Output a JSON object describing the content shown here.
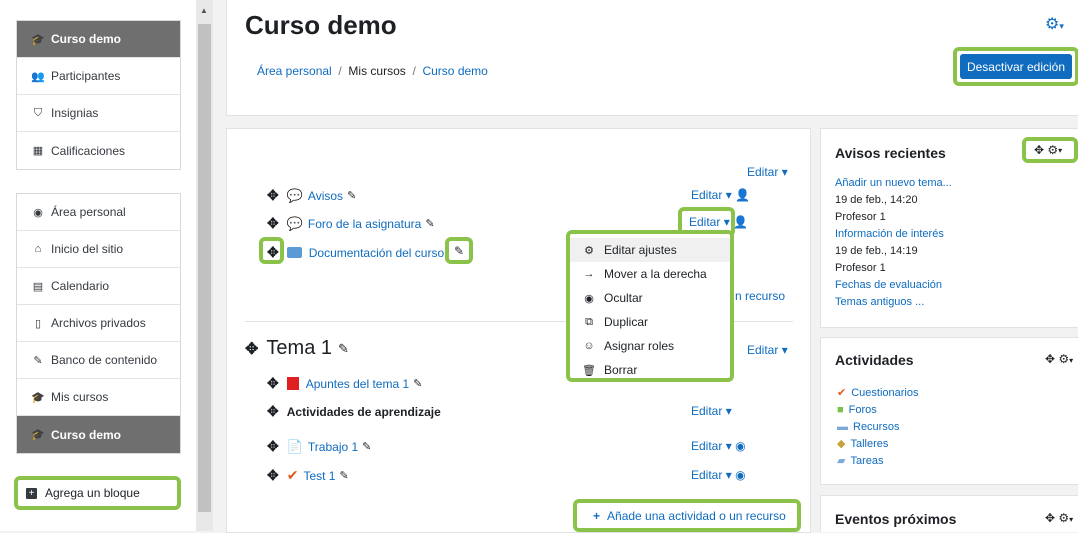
{
  "sidebar": {
    "nav1": [
      {
        "label": "Curso demo",
        "icon": "graduation-cap-icon",
        "active": true
      },
      {
        "label": "Participantes",
        "icon": "users-icon"
      },
      {
        "label": "Insignias",
        "icon": "shield-icon"
      },
      {
        "label": "Calificaciones",
        "icon": "table-icon"
      }
    ],
    "nav2": [
      {
        "label": "Área personal",
        "icon": "dashboard-icon"
      },
      {
        "label": "Inicio del sitio",
        "icon": "home-icon"
      },
      {
        "label": "Calendario",
        "icon": "calendar-icon"
      },
      {
        "label": "Archivos privados",
        "icon": "file-icon"
      },
      {
        "label": "Banco de contenido",
        "icon": "pencil-icon"
      },
      {
        "label": "Mis cursos",
        "icon": "graduation-cap-icon"
      },
      {
        "label": "Curso demo",
        "icon": "graduation-cap-icon",
        "active": true
      }
    ],
    "add_block": "Agrega un bloque"
  },
  "header": {
    "title": "Curso demo",
    "breadcrumb": [
      "Área personal",
      "Mis cursos",
      "Curso demo"
    ],
    "toggle_edit": "Desactivar edición"
  },
  "section0": {
    "edit_label": "Editar",
    "items": [
      {
        "name": "Avisos",
        "icon": "forum-icon",
        "edit": "Editar"
      },
      {
        "name": "Foro de la asignatura",
        "icon": "forum-icon",
        "edit": "Editar"
      },
      {
        "name": "Documentación del curso",
        "icon": "folder-icon"
      }
    ],
    "add_resource_partial": "n recurso"
  },
  "context_menu": [
    {
      "label": "Editar ajustes",
      "icon": "gear-icon"
    },
    {
      "label": "Mover a la derecha",
      "icon": "arrow-right-icon"
    },
    {
      "label": "Ocultar",
      "icon": "eye-icon"
    },
    {
      "label": "Duplicar",
      "icon": "copy-icon"
    },
    {
      "label": "Asignar roles",
      "icon": "user-circle-icon"
    },
    {
      "label": "Borrar",
      "icon": "trash-icon"
    }
  ],
  "section1": {
    "title": "Tema 1",
    "edit_label": "Editar",
    "items": [
      {
        "name": "Apuntes del tema 1",
        "icon": "pdf-icon"
      },
      {
        "name": "Actividades de aprendizaje",
        "label": true,
        "edit": "Editar"
      },
      {
        "name": "Trabajo 1",
        "icon": "assignment-icon",
        "edit": "Editar"
      },
      {
        "name": "Test 1",
        "icon": "quiz-icon",
        "edit": "Editar"
      }
    ],
    "add_activity": "Añade una actividad o un recurso"
  },
  "blocks": {
    "news": {
      "title": "Avisos recientes",
      "add": "Añadir un nuevo tema...",
      "posts": [
        {
          "date": "19 de feb., 14:20",
          "author": "Profesor 1",
          "title": "Información de interés"
        },
        {
          "date": "19 de feb., 14:19",
          "author": "Profesor 1",
          "title": "Fechas de evaluación"
        }
      ],
      "older": "Temas antiguos ..."
    },
    "activities": {
      "title": "Actividades",
      "items": [
        "Cuestionarios",
        "Foros",
        "Recursos",
        "Talleres",
        "Tareas"
      ]
    },
    "events": {
      "title": "Eventos próximos"
    }
  },
  "colors": {
    "accent": "#0f6cbf",
    "highlight": "#8bc34a",
    "sidebar_active": "#6f6f6f"
  }
}
